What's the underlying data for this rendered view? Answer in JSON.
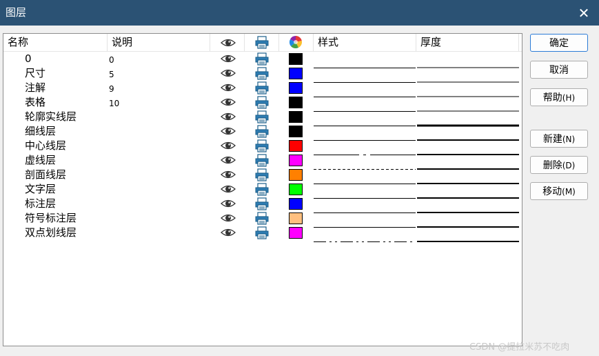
{
  "window": {
    "title": "图层",
    "close_symbol": "✕"
  },
  "columns": {
    "name": "名称",
    "description": "说明",
    "visible": "eye-icon",
    "print": "printer-icon",
    "color": "color-wheel-icon",
    "style": "样式",
    "thickness": "厚度"
  },
  "rows": [
    {
      "name": "0",
      "desc": "0",
      "color": "#000000",
      "style": "solid",
      "thickness": "thin"
    },
    {
      "name": "尺寸",
      "desc": "5",
      "color": "#0000ff",
      "style": "solid",
      "thickness": "thin"
    },
    {
      "name": "注解",
      "desc": "9",
      "color": "#0000ff",
      "style": "solid",
      "thickness": "thin"
    },
    {
      "name": "表格",
      "desc": "10",
      "color": "#000000",
      "style": "solid",
      "thickness": "thin"
    },
    {
      "name": "轮廓实线层",
      "desc": "",
      "color": "#000000",
      "style": "solid",
      "thickness": "thick"
    },
    {
      "name": "细线层",
      "desc": "",
      "color": "#000000",
      "style": "solid",
      "thickness": "medium"
    },
    {
      "name": "中心线层",
      "desc": "",
      "color": "#ff0000",
      "style": "center",
      "thickness": "medium"
    },
    {
      "name": "虚线层",
      "desc": "",
      "color": "#ff00ff",
      "style": "dashed",
      "thickness": "medium"
    },
    {
      "name": "剖面线层",
      "desc": "",
      "color": "#ff8000",
      "style": "solid",
      "thickness": "medium"
    },
    {
      "name": "文字层",
      "desc": "",
      "color": "#00ff00",
      "style": "solid",
      "thickness": "medium"
    },
    {
      "name": "标注层",
      "desc": "",
      "color": "#0000ff",
      "style": "solid",
      "thickness": "medium"
    },
    {
      "name": "符号标注层",
      "desc": "",
      "color": "#ffc080",
      "style": "solid",
      "thickness": "medium"
    },
    {
      "name": "双点划线层",
      "desc": "",
      "color": "#ff00ff",
      "style": "dash-dot-dot",
      "thickness": "medium"
    }
  ],
  "buttons": {
    "ok": "确定",
    "cancel": "取消",
    "help": "帮助",
    "help_key": "(H)",
    "new": "新建",
    "new_key": "(N)",
    "delete": "删除",
    "delete_key": "(D)",
    "move": "移动",
    "move_key": "(M)"
  },
  "watermark": "CSDN @提拉米苏不吃肉"
}
